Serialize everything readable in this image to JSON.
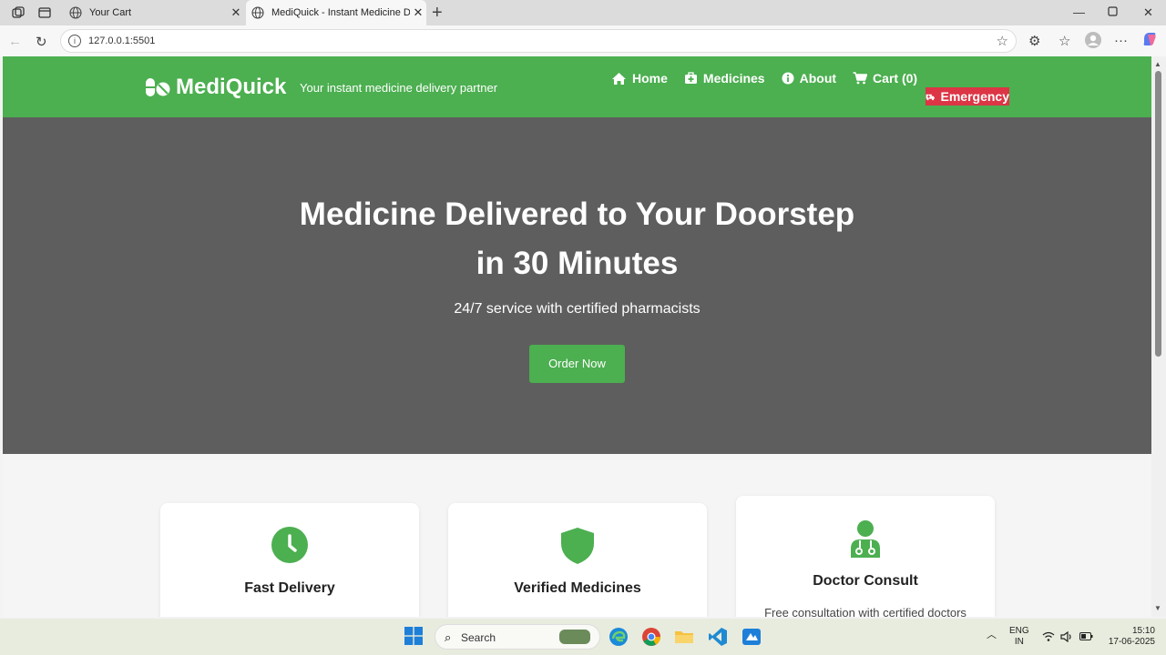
{
  "browser": {
    "tabs": [
      {
        "title": "Your Cart",
        "active": false
      },
      {
        "title": "MediQuick - Instant Medicine Del",
        "active": true
      }
    ],
    "url": "127.0.0.1:5501"
  },
  "header": {
    "brand": "MediQuick",
    "tagline": "Your instant medicine delivery partner",
    "nav": [
      {
        "label": "Home",
        "icon": "home-icon"
      },
      {
        "label": "Medicines",
        "icon": "medkit-icon"
      },
      {
        "label": "About",
        "icon": "info-icon"
      },
      {
        "label": "Cart (0)",
        "icon": "cart-icon"
      }
    ],
    "emergency": "Emergency"
  },
  "hero": {
    "title_line1": "Medicine Delivered to Your Doorstep",
    "title_line2": "in 30 Minutes",
    "subtitle": "24/7 service with certified pharmacists",
    "cta": "Order Now"
  },
  "features": [
    {
      "title": "Fast Delivery",
      "icon": "clock-icon",
      "desc": ""
    },
    {
      "title": "Verified Medicines",
      "icon": "shield-icon",
      "desc": ""
    },
    {
      "title": "Doctor Consult",
      "icon": "doctor-icon",
      "desc": "Free consultation with certified doctors"
    }
  ],
  "taskbar": {
    "search_placeholder": "Search",
    "lang_line1": "ENG",
    "lang_line2": "IN",
    "time": "15:10",
    "date": "17-06-2025"
  },
  "colors": {
    "brand_green": "#4caf50",
    "emergency_red": "#dc3545",
    "hero_bg": "#5e5e5e"
  }
}
